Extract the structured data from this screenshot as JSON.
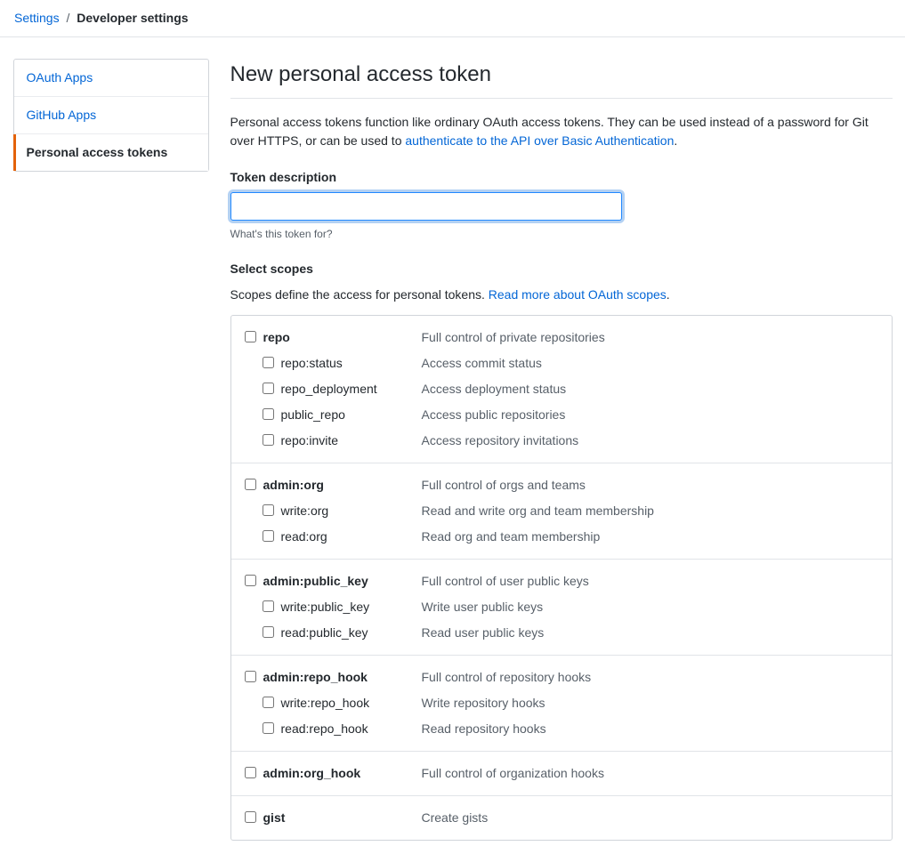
{
  "breadcrumb": {
    "settings": "Settings",
    "separator": "/",
    "current": "Developer settings"
  },
  "sidebar": {
    "items": [
      {
        "label": "OAuth Apps",
        "selected": false
      },
      {
        "label": "GitHub Apps",
        "selected": false
      },
      {
        "label": "Personal access tokens",
        "selected": true
      }
    ]
  },
  "main": {
    "title": "New personal access token",
    "intro_pre": "Personal access tokens function like ordinary OAuth access tokens. They can be used instead of a password for Git over HTTPS, or can be used to ",
    "intro_link": "authenticate to the API over Basic Authentication",
    "intro_post": ".",
    "token_desc_label": "Token description",
    "token_desc_value": "",
    "token_desc_hint": "What's this token for?",
    "scopes_heading": "Select scopes",
    "scopes_lead_pre": "Scopes define the access for personal tokens. ",
    "scopes_lead_link": "Read more about OAuth scopes",
    "scopes_lead_post": "."
  },
  "scopes": [
    {
      "name": "repo",
      "desc": "Full control of private repositories",
      "children": [
        {
          "name": "repo:status",
          "desc": "Access commit status"
        },
        {
          "name": "repo_deployment",
          "desc": "Access deployment status"
        },
        {
          "name": "public_repo",
          "desc": "Access public repositories"
        },
        {
          "name": "repo:invite",
          "desc": "Access repository invitations"
        }
      ]
    },
    {
      "name": "admin:org",
      "desc": "Full control of orgs and teams",
      "children": [
        {
          "name": "write:org",
          "desc": "Read and write org and team membership"
        },
        {
          "name": "read:org",
          "desc": "Read org and team membership"
        }
      ]
    },
    {
      "name": "admin:public_key",
      "desc": "Full control of user public keys",
      "children": [
        {
          "name": "write:public_key",
          "desc": "Write user public keys"
        },
        {
          "name": "read:public_key",
          "desc": "Read user public keys"
        }
      ]
    },
    {
      "name": "admin:repo_hook",
      "desc": "Full control of repository hooks",
      "children": [
        {
          "name": "write:repo_hook",
          "desc": "Write repository hooks"
        },
        {
          "name": "read:repo_hook",
          "desc": "Read repository hooks"
        }
      ]
    },
    {
      "name": "admin:org_hook",
      "desc": "Full control of organization hooks",
      "children": []
    },
    {
      "name": "gist",
      "desc": "Create gists",
      "children": []
    }
  ]
}
